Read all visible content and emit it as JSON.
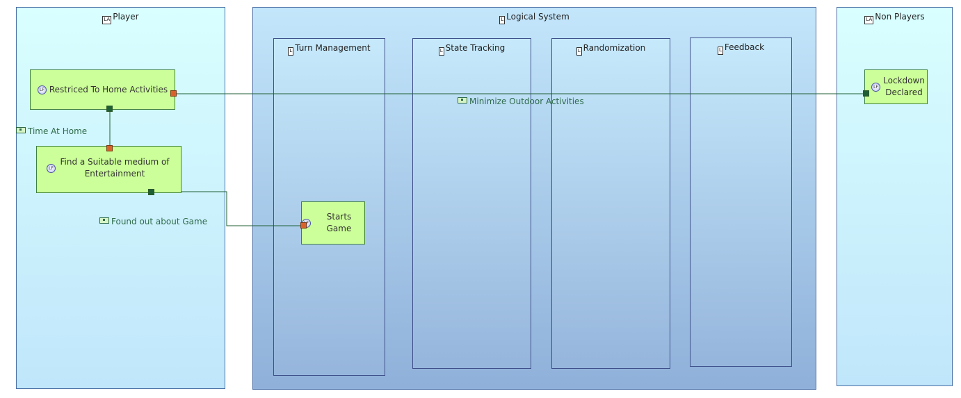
{
  "containers": {
    "player": {
      "title": "Player",
      "stereotype": "LA"
    },
    "logical_system": {
      "title": "Logical System",
      "stereotype": "L"
    },
    "non_players": {
      "title": "Non Players",
      "stereotype": "LA"
    }
  },
  "components": {
    "turn_management": {
      "title": "Turn Management",
      "stereotype": "L"
    },
    "state_tracking": {
      "title": "State Tracking",
      "stereotype": "L"
    },
    "randomization": {
      "title": "Randomization",
      "stereotype": "L"
    },
    "feedback": {
      "title": "Feedback",
      "stereotype": "L"
    }
  },
  "functions": {
    "restricted_home": {
      "label": "Restriced To Home Activities",
      "icon": "LF"
    },
    "find_medium": {
      "label": "Find a Suitable medium of Entertainment",
      "icon": "LF"
    },
    "starts_game": {
      "label": "Starts Game",
      "icon": "LF"
    },
    "lockdown": {
      "label": "Lockdown Declared",
      "icon": "LF"
    }
  },
  "exchanges": {
    "minimize_outdoor": "Minimize Outdoor Activities",
    "time_at_home": "Time At Home",
    "found_out_game": "Found out about Game"
  },
  "colors": {
    "function_fill": "#ccff99",
    "exchange_line": "#1f5f34",
    "input_port": "#d9622a",
    "output_port": "#1f5f34"
  }
}
